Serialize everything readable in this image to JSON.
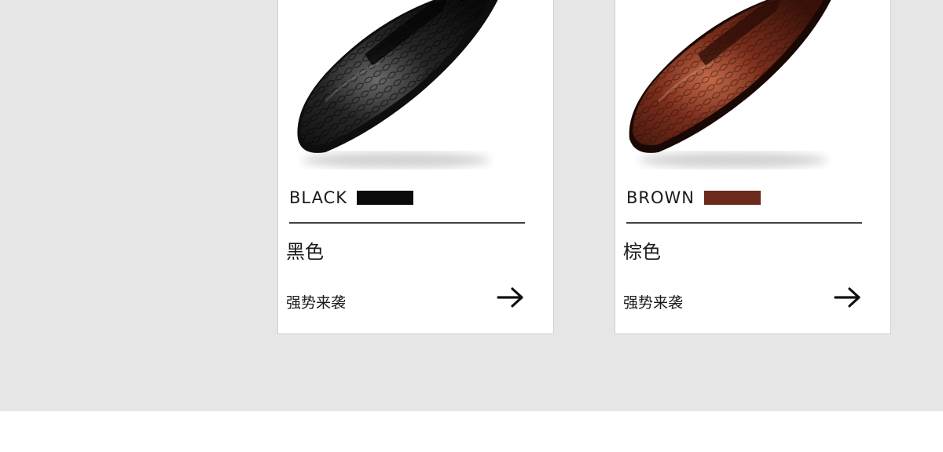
{
  "products": [
    {
      "color_name": "BLACK",
      "swatch_color": "#0a0a0a",
      "color_cn": "黑色",
      "tagline": "强势来袭",
      "arrow_icon": "arrow-right-icon",
      "image_icon": "black-crocodile-leather-shoe",
      "leather_base": "#1a1a1a",
      "leather_light": "#5a5a5a"
    },
    {
      "color_name": "BROWN",
      "swatch_color": "#6b2a1c",
      "color_cn": "棕色",
      "tagline": "强势来袭",
      "arrow_icon": "arrow-right-icon",
      "image_icon": "brown-crocodile-leather-shoe",
      "leather_base": "#5a1e12",
      "leather_light": "#b4553a"
    }
  ]
}
